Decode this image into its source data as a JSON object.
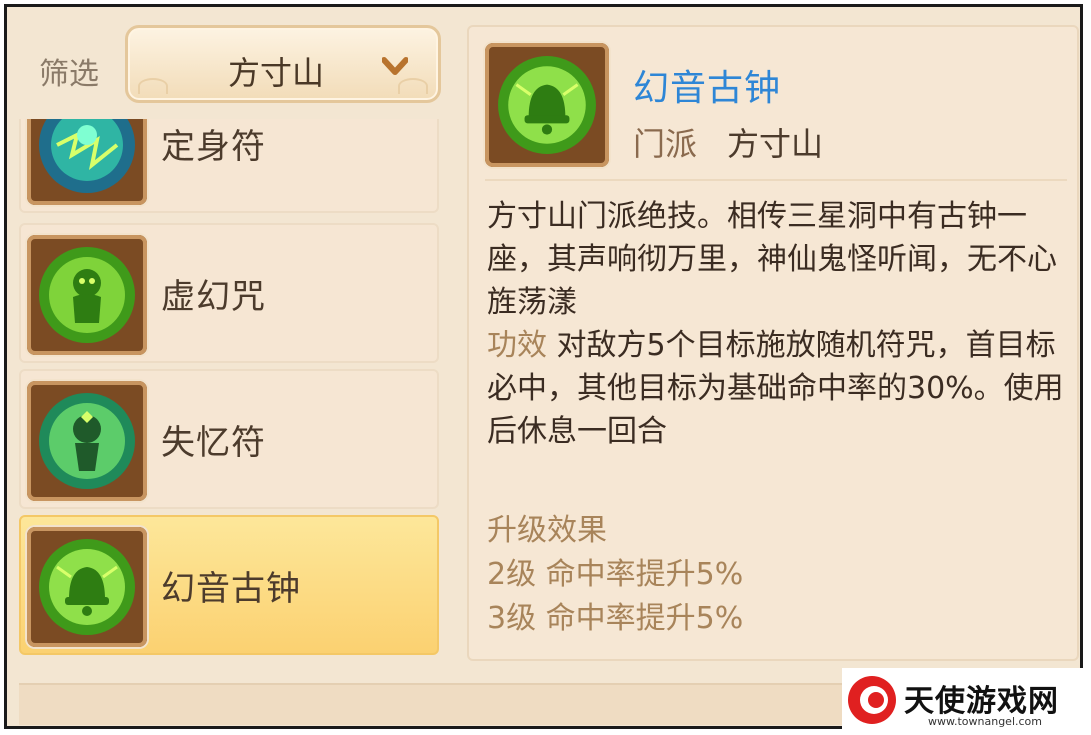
{
  "filter": {
    "label": "筛选",
    "selected": "方寸山"
  },
  "skills": [
    {
      "name": "定身符",
      "icon": "binding-talisman-icon",
      "selected": false
    },
    {
      "name": "虚幻咒",
      "icon": "illusion-spell-icon",
      "selected": false
    },
    {
      "name": "失忆符",
      "icon": "amnesia-talisman-icon",
      "selected": false
    },
    {
      "name": "幻音古钟",
      "icon": "ancient-bell-icon",
      "selected": true
    }
  ],
  "detail": {
    "title": "幻音古钟",
    "school_label": "门派",
    "school": "方寸山",
    "description": "方寸山门派绝技。相传三星洞中有古钟一座，其声响彻万里，神仙鬼怪听闻，无不心旌荡漾",
    "effect_label": "功效",
    "effect_text": "对敌方5个目标施放随机符咒，首目标必中，其他目标为基础命中率的30%。使用后休息一回合",
    "upgrade_title": "升级效果",
    "upgrades": [
      "2级  命中率提升5%",
      "3级  命中率提升5%"
    ]
  },
  "watermark": {
    "name": "天使游戏网",
    "url": "www.townangel.com"
  },
  "colors": {
    "title_blue": "#2e86d6",
    "selected_bg": "#fbd171",
    "panel_bg": "#f6e7d4",
    "label_brown": "#a8845a"
  }
}
